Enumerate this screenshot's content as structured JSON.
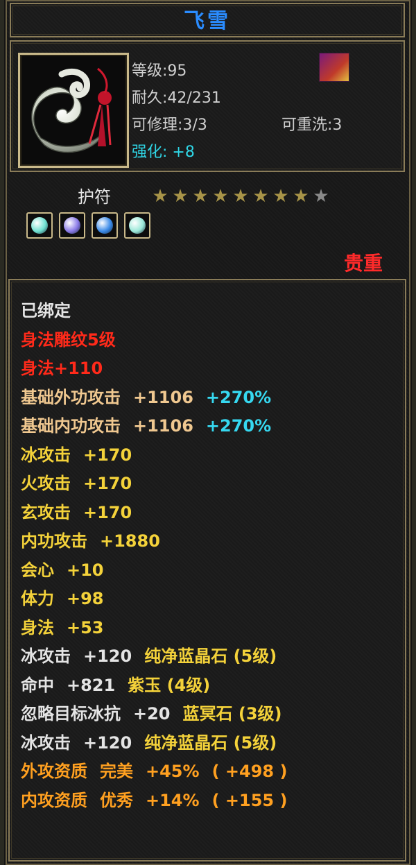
{
  "item": {
    "name": "飞雪",
    "name_color": "#2a8cff",
    "image_icon": "jade-pendant-icon",
    "badge_icon": "flame-badge-icon",
    "level_label": "等级:95",
    "durability_label": "耐久:42/231",
    "repairable_label": "可修理:3/3",
    "rewash_label": "可重洗:3",
    "enhance_label": "强化: +8",
    "amulet_label": "护符",
    "stars_filled": 8,
    "stars_total": 9,
    "rarity": "贵重",
    "gems": [
      {
        "icon": "gem-ice-icon",
        "color": "#6fe0d0"
      },
      {
        "icon": "gem-purple-icon",
        "color": "#8a7ae8"
      },
      {
        "icon": "gem-blue-icon",
        "color": "#3a8ae8"
      },
      {
        "icon": "gem-teal-icon",
        "color": "#9ae8d8"
      }
    ]
  },
  "attributes": [
    {
      "color": "white",
      "parts": [
        "已绑定"
      ]
    },
    {
      "color": "red",
      "parts": [
        "身法雕纹5级"
      ]
    },
    {
      "color": "red",
      "parts": [
        "身法+110"
      ]
    },
    {
      "color": "tan",
      "parts": [
        "基础外功攻击",
        "+1106"
      ],
      "extra": "+270%"
    },
    {
      "color": "tan",
      "parts": [
        "基础内功攻击",
        "+1106"
      ],
      "extra": "+270%"
    },
    {
      "color": "gold",
      "parts": [
        "冰攻击",
        "+170"
      ]
    },
    {
      "color": "gold",
      "parts": [
        "火攻击",
        "+170"
      ]
    },
    {
      "color": "gold",
      "parts": [
        "玄攻击",
        "+170"
      ]
    },
    {
      "color": "gold",
      "parts": [
        "内功攻击",
        "+1880"
      ]
    },
    {
      "color": "gold",
      "parts": [
        "会心",
        "+10"
      ]
    },
    {
      "color": "gold",
      "parts": [
        "体力",
        "+98"
      ]
    },
    {
      "color": "gold",
      "parts": [
        "身法",
        "+53"
      ]
    },
    {
      "color": "white",
      "parts": [
        "冰攻击",
        "+120"
      ],
      "gem": "纯净蓝晶石 (5级)"
    },
    {
      "color": "white",
      "parts": [
        "命中",
        "+821"
      ],
      "gem": "紫玉 (4级)"
    },
    {
      "color": "white",
      "parts": [
        "忽略目标冰抗",
        "+20"
      ],
      "gem": "蓝冥石 (3级)"
    },
    {
      "color": "white",
      "parts": [
        "冰攻击",
        "+120"
      ],
      "gem": "纯净蓝晶石 (5级)"
    },
    {
      "color": "orange",
      "parts": [
        "外攻资质",
        "完美",
        "+45%",
        "( +498 )"
      ]
    },
    {
      "color": "orange",
      "parts": [
        "内攻资质",
        "优秀",
        "+14%",
        "( +155 )"
      ]
    }
  ]
}
